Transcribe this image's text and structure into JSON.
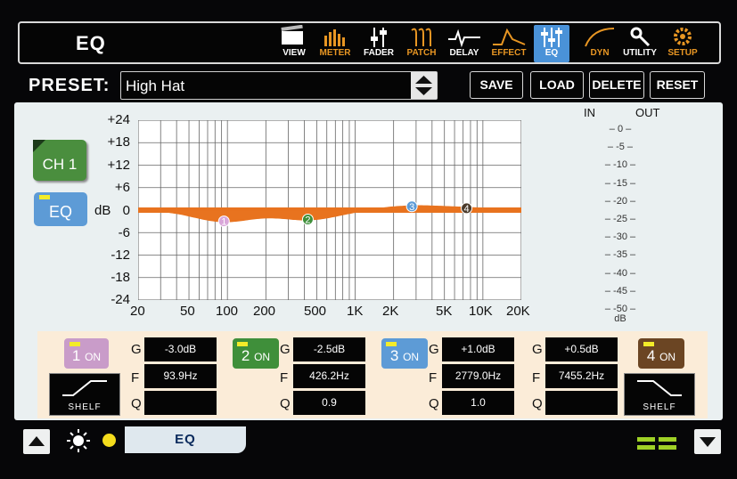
{
  "header": {
    "title": "EQ",
    "nav": [
      {
        "label": "VIEW",
        "icon": "view-icon"
      },
      {
        "label": "METER",
        "icon": "meter-icon"
      },
      {
        "label": "FADER",
        "icon": "fader-icon"
      },
      {
        "label": "PATCH",
        "icon": "patch-icon"
      },
      {
        "label": "DELAY",
        "icon": "delay-icon"
      },
      {
        "label": "EFFECT",
        "icon": "effect-icon"
      },
      {
        "label": "EQ",
        "icon": "eq-icon",
        "active": true
      },
      {
        "label": "DYN",
        "icon": "dyn-icon"
      },
      {
        "label": "UTILITY",
        "icon": "utility-icon"
      },
      {
        "label": "SETUP",
        "icon": "setup-icon"
      }
    ]
  },
  "preset": {
    "label": "PRESET:",
    "value": "High Hat",
    "buttons": {
      "save": "SAVE",
      "load": "LOAD",
      "delete": "DELETE",
      "reset": "RESET"
    }
  },
  "channel": {
    "label": "CH 1",
    "eq_label": "EQ"
  },
  "graph": {
    "y_ticks": [
      "+24",
      "+18",
      "+12",
      "+6",
      "0",
      "-6",
      "-12",
      "-18",
      "-24"
    ],
    "y_unit": "dB",
    "x_ticks": [
      "20",
      "50",
      "100",
      "200",
      "500",
      "1K",
      "2K",
      "5K",
      "10K",
      "20K"
    ],
    "curve_color": "#e8731f",
    "band_markers": [
      {
        "label": "1",
        "freq_hz": 93.9,
        "gain_db": -3.0,
        "color": "#d9a6d9"
      },
      {
        "label": "2",
        "freq_hz": 426.2,
        "gain_db": -2.5,
        "color": "#3f8f3a"
      },
      {
        "label": "3",
        "freq_hz": 2779.0,
        "gain_db": 1.0,
        "color": "#5d9bd6"
      },
      {
        "label": "4",
        "freq_hz": 7455.2,
        "gain_db": 0.5,
        "color": "#4a3a2a"
      }
    ]
  },
  "meter": {
    "in_label": "IN",
    "out_label": "OUT",
    "scale": [
      "0",
      "-5",
      "-10",
      "-15",
      "-20",
      "-25",
      "-30",
      "-35",
      "-40",
      "-45",
      "-50"
    ],
    "unit": "dB"
  },
  "bands": [
    {
      "num": "1",
      "on": "ON",
      "color": "#c99cc9",
      "G": "-3.0dB",
      "F": "93.9Hz",
      "Q": "",
      "shelf": "SHELF"
    },
    {
      "num": "2",
      "on": "ON",
      "color": "#3f8f3a",
      "G": "-2.5dB",
      "F": "426.2Hz",
      "Q": "0.9"
    },
    {
      "num": "3",
      "on": "ON",
      "color": "#5d9bd6",
      "G": "+1.0dB",
      "F": "2779.0Hz",
      "Q": "1.0"
    },
    {
      "num": "4",
      "on": "ON",
      "color": "#6b4523",
      "G": "+0.5dB",
      "F": "7455.2Hz",
      "Q": "",
      "shelf": "SHELF"
    }
  ],
  "param_labels": {
    "g": "G",
    "f": "F",
    "q": "Q"
  },
  "footer": {
    "tab": "EQ"
  }
}
